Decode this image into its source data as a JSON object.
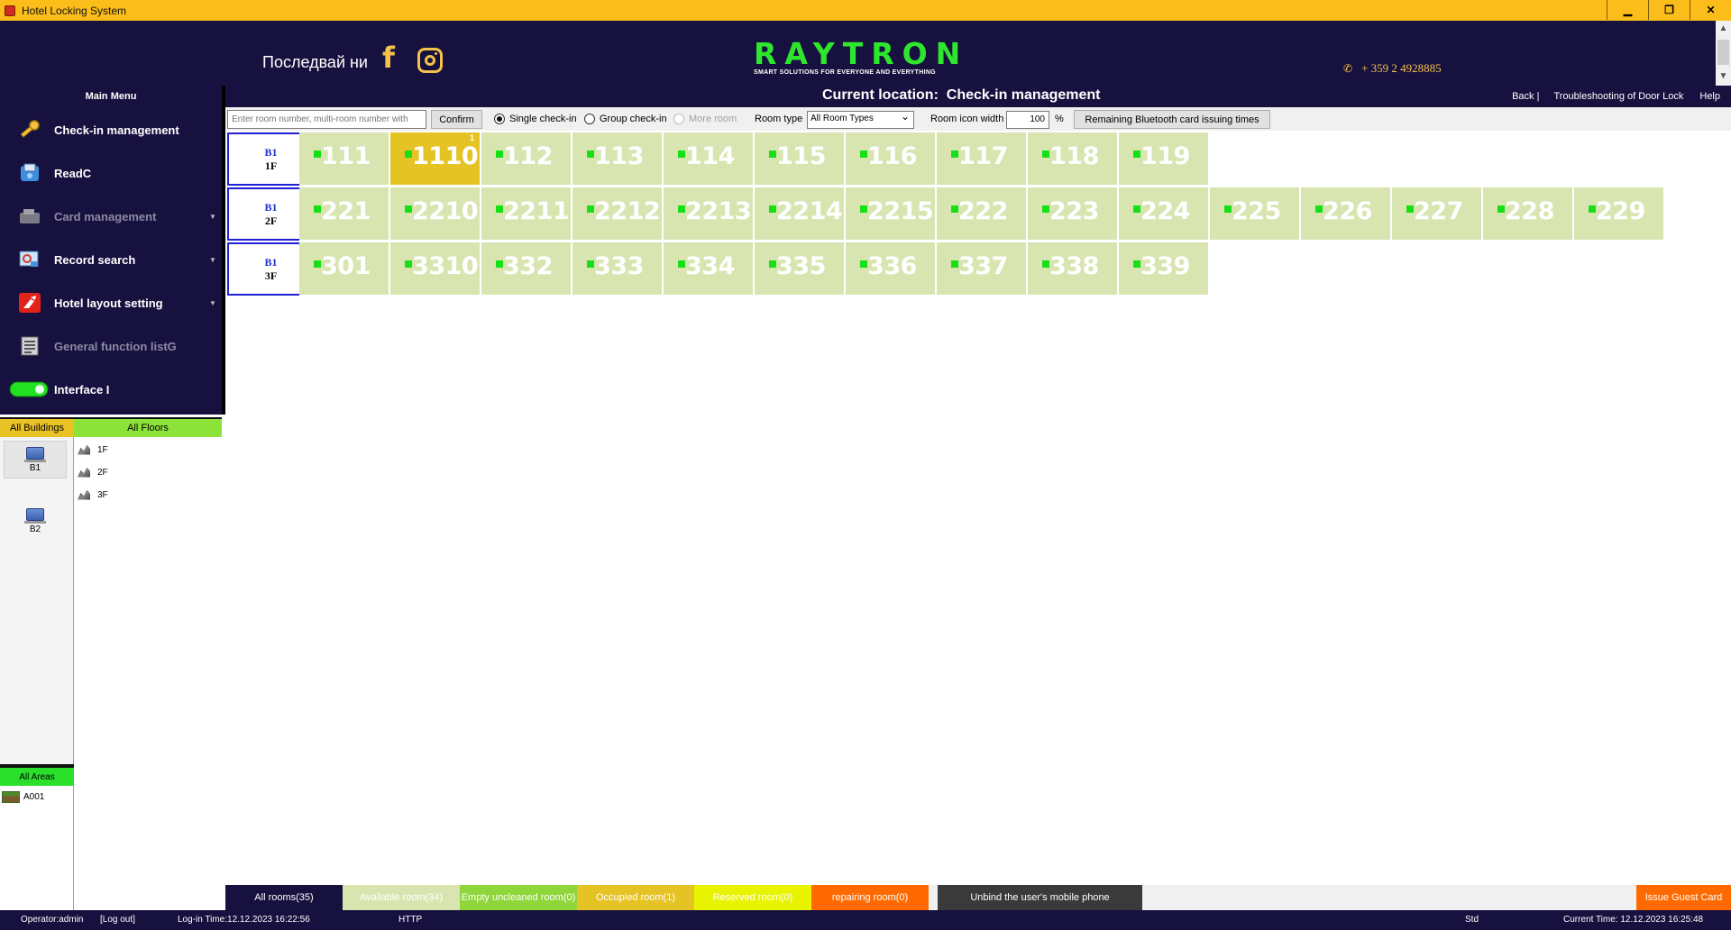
{
  "window": {
    "title": "Hotel Locking System",
    "controls": [
      "▁",
      "❐",
      "✕"
    ]
  },
  "header": {
    "follow_text": "Последвай ни",
    "brand": "RAYTRON",
    "tagline": "SMART SOLUTIONS FOR EVERYONE AND EVERYTHING",
    "phone": "+ 359 2 4928885"
  },
  "sidebar": {
    "title": "Main Menu",
    "items": [
      {
        "label": "Check-in management",
        "icon": "key-icon",
        "disabled": false,
        "caret": false
      },
      {
        "label": "ReadC",
        "icon": "card-reader-icon",
        "disabled": false,
        "caret": false
      },
      {
        "label": "Card management",
        "icon": "card-management-icon",
        "disabled": true,
        "caret": true
      },
      {
        "label": "Record search",
        "icon": "record-search-icon",
        "disabled": false,
        "caret": true
      },
      {
        "label": "Hotel layout setting",
        "icon": "layout-setting-icon",
        "disabled": false,
        "caret": true
      },
      {
        "label": "General function listG",
        "icon": "function-list-icon",
        "disabled": true,
        "caret": false
      },
      {
        "label": "Interface I",
        "icon": "toggle-icon",
        "disabled": false,
        "caret": false
      }
    ]
  },
  "tree": {
    "buildings_tab": "All Buildings",
    "floors_tab": "All Floors",
    "areas_tab": "All Areas",
    "buildings": [
      "B1",
      "B2"
    ],
    "floors": [
      "1F",
      "2F",
      "3F"
    ],
    "areas": [
      "A001"
    ]
  },
  "location": {
    "prefix": "Current location:",
    "page": "Check-in management",
    "links": [
      "Back  |",
      "Troubleshooting of Door Lock",
      "Help"
    ]
  },
  "toolbar": {
    "search_placeholder": "Enter room number, multi-room number with",
    "confirm": "Confirm",
    "single_checkin": "Single check-in",
    "group_checkin": "Group check-in",
    "more_room": "More room",
    "room_type_label": "Room type",
    "room_type_value": "All Room Types",
    "icon_width_label": "Room icon width",
    "icon_width_value": "100",
    "percent": "%",
    "bluetooth_button": "Remaining Bluetooth card issuing times"
  },
  "floors": [
    {
      "building": "B1",
      "floor": "1F",
      "rooms": [
        {
          "num": "111"
        },
        {
          "num": "1110",
          "occupied": true,
          "badge": "1"
        },
        {
          "num": "112"
        },
        {
          "num": "113"
        },
        {
          "num": "114"
        },
        {
          "num": "115"
        },
        {
          "num": "116"
        },
        {
          "num": "117"
        },
        {
          "num": "118"
        },
        {
          "num": "119"
        }
      ]
    },
    {
      "building": "B1",
      "floor": "2F",
      "rooms": [
        {
          "num": "221"
        },
        {
          "num": "2210"
        },
        {
          "num": "2211"
        },
        {
          "num": "2212"
        },
        {
          "num": "2213"
        },
        {
          "num": "2214"
        },
        {
          "num": "2215"
        },
        {
          "num": "222"
        },
        {
          "num": "223"
        },
        {
          "num": "224"
        },
        {
          "num": "225"
        },
        {
          "num": "226"
        },
        {
          "num": "227"
        },
        {
          "num": "228"
        },
        {
          "num": "229"
        }
      ]
    },
    {
      "building": "B1",
      "floor": "3F",
      "rooms": [
        {
          "num": "301"
        },
        {
          "num": "3310"
        },
        {
          "num": "332"
        },
        {
          "num": "333"
        },
        {
          "num": "334"
        },
        {
          "num": "335"
        },
        {
          "num": "336"
        },
        {
          "num": "337"
        },
        {
          "num": "338"
        },
        {
          "num": "339"
        }
      ]
    }
  ],
  "legend": {
    "all_rooms": "All rooms(35)",
    "available": "Available room(34)",
    "empty_uncleaned": "Empty uncleaned room(0)",
    "occupied": "Occupied room(1)",
    "reserved": "Reserved room(0)",
    "repairing": "repairing room(0)",
    "unbind": "Unbind the user's mobile phone",
    "issue_guest": "Issue Guest Card"
  },
  "colors": {
    "navy": "#17113f",
    "available": "#d9e5b1",
    "occupied": "#e6c325",
    "brand_green": "#2ee62e"
  },
  "status": {
    "operator": "Operator:admin",
    "logout": "[Log out]",
    "login_time": "Log-in Time:12.12.2023 16:22:56",
    "protocol": "HTTP",
    "mode": "Std",
    "current_time": "Current Time:   12.12.2023 16:25:48"
  }
}
